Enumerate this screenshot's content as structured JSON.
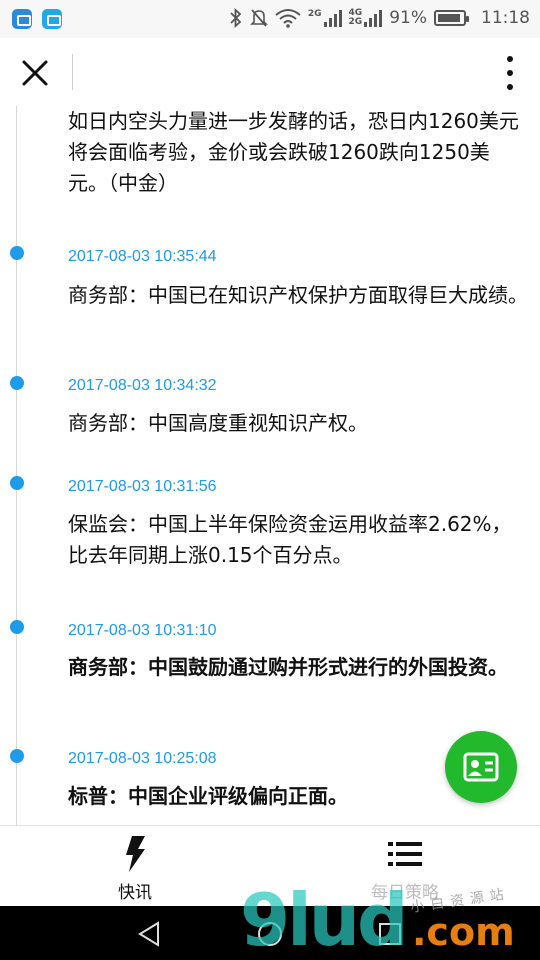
{
  "status_bar": {
    "signal_label_top": "2G",
    "net_top": "4G",
    "net_bottom": "2G",
    "battery_percent": "91%",
    "battery_level": 0.91,
    "time": "11:18",
    "icons": [
      "gallery-icon",
      "message-icon",
      "bluetooth-icon",
      "mute-icon",
      "wifi-icon",
      "signal-icon",
      "battery-icon"
    ]
  },
  "header": {
    "close_icon": "close-icon",
    "menu_icon": "more-vertical-icon"
  },
  "feed": {
    "accent_color": "#1e9be9",
    "items": [
      {
        "time": "",
        "text": "如日内空头力量进一步发酵的话，恐日内1260美元将会面临考验，金价或会跌破1260跌向1250美元。（中金）",
        "bold": false
      },
      {
        "time": "2017-08-03 10:35:44",
        "text": "商务部：中国已在知识产权保护方面取得巨大成绩。",
        "bold": false
      },
      {
        "time": "2017-08-03 10:34:32",
        "text": "商务部：中国高度重视知识产权。",
        "bold": false
      },
      {
        "time": "2017-08-03 10:31:56",
        "text": "保监会：中国上半年保险资金运用收益率2.62%，比去年同期上涨0.15个百分点。",
        "bold": false
      },
      {
        "time": "2017-08-03 10:31:10",
        "text": "商务部：中国鼓励通过购并形式进行的外国投资。",
        "bold": true
      },
      {
        "time": "2017-08-03 10:25:08",
        "text": "标普：中国企业评级偏向正面。",
        "bold": true
      }
    ]
  },
  "fab": {
    "icon": "contact-card-icon",
    "color": "#22b92c"
  },
  "tabbar": {
    "tabs": [
      {
        "label": "快讯",
        "icon": "flash-icon",
        "active": true
      },
      {
        "label": "每日策略",
        "icon": "list-icon",
        "active": false
      }
    ]
  },
  "navbar": {
    "icons": [
      "back-icon",
      "home-icon",
      "recent-apps-icon"
    ]
  },
  "watermark": {
    "logo": "9lud",
    "domain": ".com",
    "tagline": "小白资源站"
  }
}
